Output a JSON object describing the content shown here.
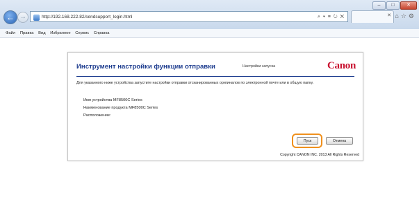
{
  "browser": {
    "url": "http://192.168.222.82/sendsupport_login.html",
    "address_tools": "⌕ ▾ ≡ ↻ ✕",
    "window_buttons": {
      "minimize": "–",
      "maximize": "□",
      "close": "✕"
    },
    "menu": [
      "Файл",
      "Правка",
      "Вид",
      "Избранное",
      "Сервис",
      "Справка"
    ]
  },
  "page": {
    "title": "Инструмент настройки функции отправки",
    "subtitle": "Настройки запуска",
    "logo": "Canon",
    "description": "Для указанного ниже устройства запустите настройки отправки отсканированных оригиналов по электронной почте или в общую папку.",
    "device_name": "Имя устройства MF8500C Series",
    "product_name": "Наименование продукта MF8500C Series",
    "location": "Расположение:",
    "start_button": "Пуск",
    "cancel_button": "Отмена",
    "copyright": "Copyright CANON INC. 2013 All Rights Reserved"
  },
  "colors": {
    "title": "#1e3d8f",
    "logo": "#c8102e",
    "highlight": "#f0901c"
  }
}
